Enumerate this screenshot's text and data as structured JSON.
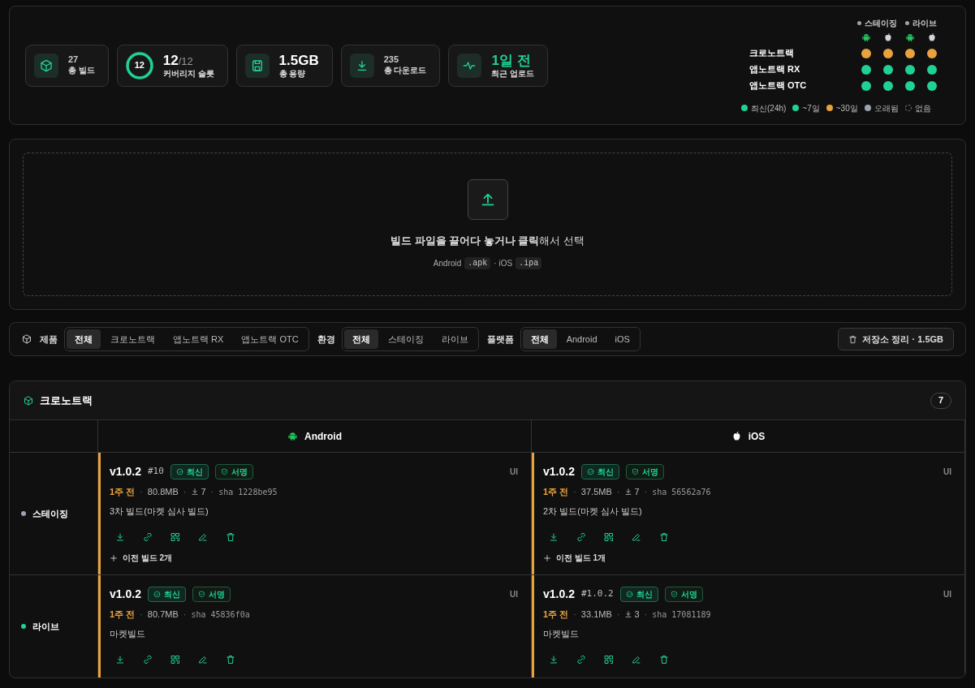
{
  "stats": [
    {
      "kind": "box",
      "value": "27",
      "label": "총 빌드"
    },
    {
      "kind": "ring",
      "ring_text": "12",
      "value": "12",
      "total": "/12",
      "label": "커버리지 슬롯"
    },
    {
      "kind": "disk",
      "value": "1.5GB",
      "label": "총 용량"
    },
    {
      "kind": "download",
      "value": "235",
      "label": "총 다운로드"
    },
    {
      "kind": "pulse",
      "value": "1일 전",
      "label": "최근 업로드"
    }
  ],
  "matrix": {
    "envs": [
      {
        "label": "스테이징"
      },
      {
        "label": "라이브"
      }
    ],
    "rows": [
      {
        "name": "크로노트랙",
        "dots": [
          {
            "color": "#e8a33d"
          },
          {
            "color": "#e8a33d"
          },
          {
            "color": "#e8a33d"
          },
          {
            "color": "#e8a33d"
          }
        ]
      },
      {
        "name": "앱노트랙 RX",
        "dots": [
          {
            "color": "#1fd293"
          },
          {
            "color": "#1fd293"
          },
          {
            "color": "#1fd293"
          },
          {
            "color": "#1fd293"
          }
        ]
      },
      {
        "name": "앱노트랙 OTC",
        "dots": [
          {
            "color": "#1fd293"
          },
          {
            "color": "#1fd293"
          },
          {
            "color": "#1fd293"
          },
          {
            "color": "#1fd293"
          }
        ]
      }
    ],
    "legend": [
      {
        "kind": "solid",
        "label": "최신(24h)",
        "color": "#1fd293"
      },
      {
        "kind": "solid",
        "label": "~7일",
        "color": "#1fd293"
      },
      {
        "kind": "solid",
        "label": "~30일",
        "color": "#e8a33d"
      },
      {
        "kind": "solid",
        "label": "오래됨",
        "color": "#9ca3af"
      },
      {
        "kind": "dashed",
        "label": "없음",
        "color": "#6b7280"
      }
    ]
  },
  "upload": {
    "title": "**빌드 파일을 끌어다 놓거나 클릭**해서 선택",
    "hint": [
      {
        "kind": "text",
        "text": "Android"
      },
      {
        "kind": "code",
        "text": ".apk"
      },
      {
        "kind": "text",
        "text": "· iOS"
      },
      {
        "kind": "code",
        "text": ".ipa"
      }
    ]
  },
  "filters": [
    {
      "label": "제품",
      "options": [
        {
          "label": "전체",
          "selected": true
        },
        {
          "label": "크로노트랙",
          "selected": false
        },
        {
          "label": "앱노트랙 RX",
          "selected": false
        },
        {
          "label": "앱노트랙 OTC",
          "selected": false
        }
      ]
    },
    {
      "label": "환경",
      "options": [
        {
          "label": "전체",
          "selected": true
        },
        {
          "label": "스테이징",
          "selected": false
        },
        {
          "label": "라이브",
          "selected": false
        }
      ]
    },
    {
      "label": "플랫폼",
      "options": [
        {
          "label": "전체",
          "selected": true
        },
        {
          "label": "Android",
          "selected": false
        },
        {
          "label": "iOS",
          "selected": false
        }
      ]
    }
  ],
  "cleanup_button": "저장소 정리 · 1.5GB",
  "section": {
    "title": "크로노트랙",
    "count": "7",
    "columns": [
      {
        "kind": "android",
        "label": "Android"
      },
      {
        "kind": "apple",
        "label": "iOS"
      }
    ],
    "rows": [
      {
        "env": "스테이징",
        "color": "#9ca3af",
        "cells": [
          {
            "version": "v1.0.2",
            "build": "#10",
            "badges": [
              {
                "kind": "check",
                "label": "최신"
              },
              {
                "kind": "shield",
                "label": "서명"
              }
            ],
            "tag": "UI",
            "sep": "·",
            "age": "1주 전",
            "size": "80.8MB",
            "downloads": "7",
            "sha": "sha 1228be95",
            "note": "3차 빌드(마켓 심사 빌드)",
            "more": "이전 빌드 2개"
          },
          {
            "version": "v1.0.2",
            "badges": [
              {
                "kind": "check",
                "label": "최신"
              },
              {
                "kind": "shield",
                "label": "서명"
              }
            ],
            "tag": "UI",
            "sep": "·",
            "age": "1주 전",
            "size": "37.5MB",
            "downloads": "7",
            "sha": "sha 56562a76",
            "note": "2차 빌드(마켓 심사 빌드)",
            "more": "이전 빌드 1개"
          }
        ]
      },
      {
        "env": "라이브",
        "color": "#1fd293",
        "cells": [
          {
            "version": "v1.0.2",
            "badges": [
              {
                "kind": "check",
                "label": "최신"
              },
              {
                "kind": "shield",
                "label": "서명"
              }
            ],
            "tag": "UI",
            "sep": "·",
            "age": "1주 전",
            "size": "80.7MB",
            "sha": "sha 45836f0a",
            "note": "마켓빌드"
          },
          {
            "version": "v1.0.2",
            "build": "#1.0.2",
            "badges": [
              {
                "kind": "check",
                "label": "최신"
              },
              {
                "kind": "shield",
                "label": "서명"
              }
            ],
            "tag": "UI",
            "sep": "·",
            "age": "1주 전",
            "size": "33.1MB",
            "downloads": "3",
            "sha": "sha 17081189",
            "note": "마켓빌드"
          }
        ]
      }
    ]
  }
}
